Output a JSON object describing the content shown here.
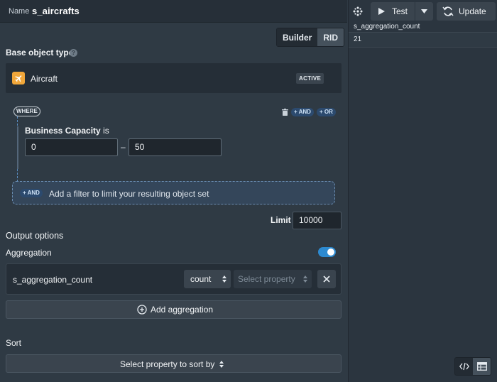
{
  "header": {
    "name_label": "Name",
    "name_value": "s_aircrafts"
  },
  "mode_toggle": {
    "builder": "Builder",
    "rid": "RID",
    "active": "RID"
  },
  "base_object": {
    "label": "Base object type",
    "name": "Aircraft",
    "status": "ACTIVE",
    "icon": "airplane-icon",
    "icon_color": "#f1a73a"
  },
  "where": {
    "label": "WHERE",
    "and_chip": "+ AND",
    "or_chip": "+ OR",
    "condition": {
      "property": "Business Capacity",
      "operator": "is",
      "min": "0",
      "max": "50",
      "separator": "–"
    },
    "add_filter": {
      "chip": "+ AND",
      "text": "Add a filter to limit your resulting object set"
    }
  },
  "limit": {
    "label": "Limit",
    "value": "10000"
  },
  "output": {
    "title": "Output options",
    "aggregation_label": "Aggregation",
    "aggregation_enabled": true,
    "aggregation": {
      "name": "s_aggregation_count",
      "function": "count",
      "property_placeholder": "Select property"
    },
    "add_aggregation": "Add aggregation"
  },
  "sort": {
    "label": "Sort",
    "button": "Select property to sort by"
  },
  "results": {
    "test_button": "Test",
    "update_button": "Update",
    "column": "s_aggregation_count",
    "value": "21"
  },
  "colors": {
    "accent": "#2d8ad0",
    "chip": "#2c4a6e"
  }
}
